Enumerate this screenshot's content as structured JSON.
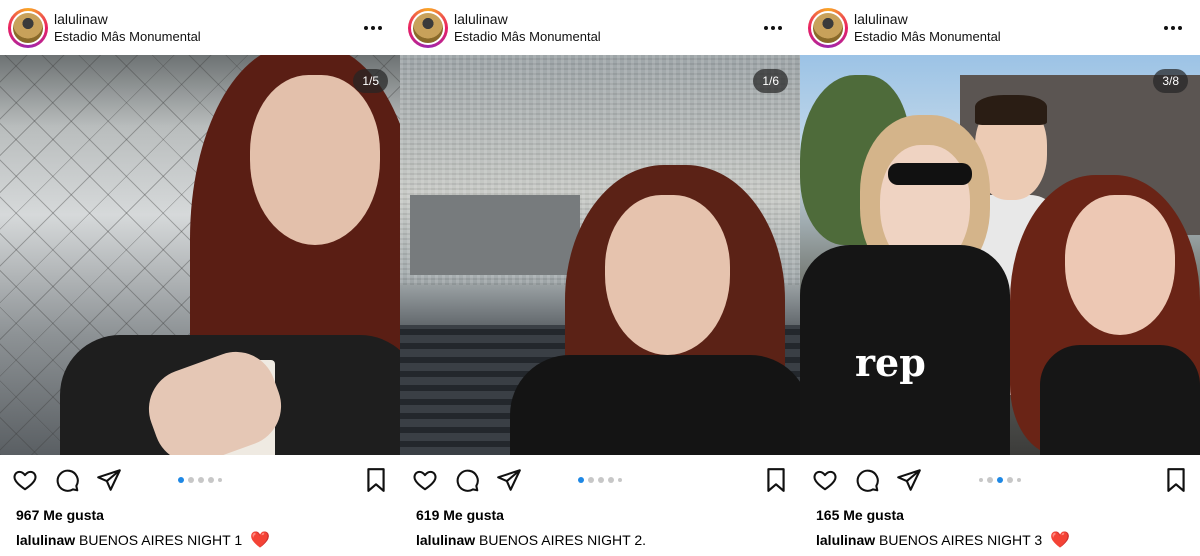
{
  "posts": [
    {
      "username": "lalulinaw",
      "location": "Estadio Mâs Monumental",
      "counter": "1/5",
      "likes": "967 Me gusta",
      "caption_user": "lalulinaw",
      "caption_text": "BUENOS AIRES NIGHT 1",
      "caption_emoji": "❤️",
      "carousel_total": 5,
      "carousel_active": 1
    },
    {
      "username": "lalulinaw",
      "location": "Estadio Mâs Monumental",
      "counter": "1/6",
      "likes": "619 Me gusta",
      "caption_user": "lalulinaw",
      "caption_text": "BUENOS AIRES NIGHT 2.",
      "caption_emoji": "",
      "carousel_total": 6,
      "carousel_active": 1
    },
    {
      "username": "lalulinaw",
      "location": "Estadio Mâs Monumental",
      "counter": "3/8",
      "likes": "165 Me gusta",
      "caption_user": "lalulinaw",
      "caption_text": "BUENOS AIRES NIGHT 3",
      "caption_emoji": "❤️",
      "carousel_total": 8,
      "carousel_active": 3,
      "shirt_text": "rep"
    }
  ],
  "icons": {
    "like": "heart-outline",
    "comment": "speech-bubble",
    "share": "paper-plane",
    "save": "bookmark",
    "more": "three-dots"
  },
  "colors": {
    "carousel_active": "#1e88e5",
    "carousel_inactive": "#c7c7c7",
    "emoji_heart": "#e0212d"
  }
}
